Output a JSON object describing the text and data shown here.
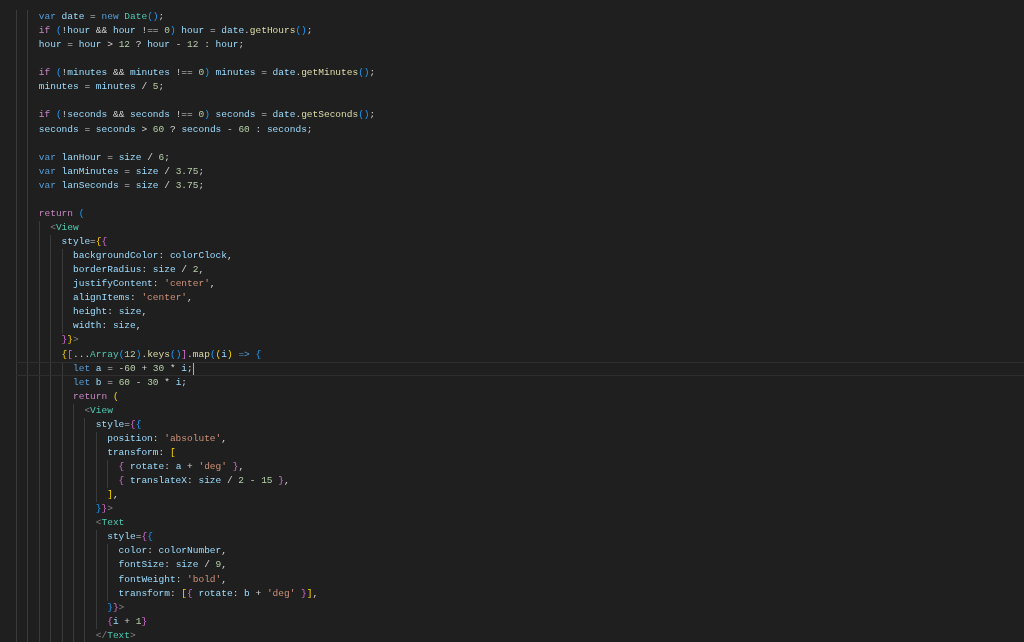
{
  "editor": {
    "lines": [
      {
        "kind": "code",
        "current": false,
        "tokens": [
          {
            "kind": "storage",
            "text": "    var "
          },
          {
            "kind": "variable",
            "text": "date"
          },
          {
            "kind": "plain",
            "text": " = "
          },
          {
            "kind": "storage",
            "text": "new "
          },
          {
            "kind": "type",
            "text": "Date"
          },
          {
            "kind": "blue",
            "text": "()"
          },
          {
            "kind": "plain",
            "text": ";"
          }
        ]
      },
      {
        "kind": "code",
        "current": false,
        "tokens": [
          {
            "kind": "keyword",
            "text": "    if "
          },
          {
            "kind": "blue",
            "text": "("
          },
          {
            "kind": "plain",
            "text": "!"
          },
          {
            "kind": "variable",
            "text": "hour"
          },
          {
            "kind": "plain",
            "text": " && "
          },
          {
            "kind": "variable",
            "text": "hour"
          },
          {
            "kind": "plain",
            "text": " !== "
          },
          {
            "kind": "number",
            "text": "0"
          },
          {
            "kind": "blue",
            "text": ")"
          },
          {
            "kind": "variable",
            "text": " hour"
          },
          {
            "kind": "plain",
            "text": " = "
          },
          {
            "kind": "variable",
            "text": "date"
          },
          {
            "kind": "plain",
            "text": "."
          },
          {
            "kind": "function",
            "text": "getHours"
          },
          {
            "kind": "blue",
            "text": "()"
          },
          {
            "kind": "plain",
            "text": ";"
          }
        ]
      },
      {
        "kind": "code",
        "current": false,
        "tokens": [
          {
            "kind": "variable",
            "text": "    hour"
          },
          {
            "kind": "plain",
            "text": " = "
          },
          {
            "kind": "variable",
            "text": "hour"
          },
          {
            "kind": "plain",
            "text": " > "
          },
          {
            "kind": "number",
            "text": "12"
          },
          {
            "kind": "plain",
            "text": " ? "
          },
          {
            "kind": "variable",
            "text": "hour"
          },
          {
            "kind": "plain",
            "text": " - "
          },
          {
            "kind": "number",
            "text": "12"
          },
          {
            "kind": "plain",
            "text": " : "
          },
          {
            "kind": "variable",
            "text": "hour"
          },
          {
            "kind": "plain",
            "text": ";"
          }
        ]
      },
      {
        "kind": "blank",
        "current": false
      },
      {
        "kind": "code",
        "current": false,
        "tokens": [
          {
            "kind": "keyword",
            "text": "    if "
          },
          {
            "kind": "blue",
            "text": "("
          },
          {
            "kind": "plain",
            "text": "!"
          },
          {
            "kind": "variable",
            "text": "minutes"
          },
          {
            "kind": "plain",
            "text": " && "
          },
          {
            "kind": "variable",
            "text": "minutes"
          },
          {
            "kind": "plain",
            "text": " !== "
          },
          {
            "kind": "number",
            "text": "0"
          },
          {
            "kind": "blue",
            "text": ")"
          },
          {
            "kind": "variable",
            "text": " minutes"
          },
          {
            "kind": "plain",
            "text": " = "
          },
          {
            "kind": "variable",
            "text": "date"
          },
          {
            "kind": "plain",
            "text": "."
          },
          {
            "kind": "function",
            "text": "getMinutes"
          },
          {
            "kind": "blue",
            "text": "()"
          },
          {
            "kind": "plain",
            "text": ";"
          }
        ]
      },
      {
        "kind": "code",
        "current": false,
        "tokens": [
          {
            "kind": "variable",
            "text": "    minutes"
          },
          {
            "kind": "plain",
            "text": " = "
          },
          {
            "kind": "variable",
            "text": "minutes"
          },
          {
            "kind": "plain",
            "text": " / "
          },
          {
            "kind": "number",
            "text": "5"
          },
          {
            "kind": "plain",
            "text": ";"
          }
        ]
      },
      {
        "kind": "blank",
        "current": false
      },
      {
        "kind": "code",
        "current": false,
        "tokens": [
          {
            "kind": "keyword",
            "text": "    if "
          },
          {
            "kind": "blue",
            "text": "("
          },
          {
            "kind": "plain",
            "text": "!"
          },
          {
            "kind": "variable",
            "text": "seconds"
          },
          {
            "kind": "plain",
            "text": " && "
          },
          {
            "kind": "variable",
            "text": "seconds"
          },
          {
            "kind": "plain",
            "text": " !== "
          },
          {
            "kind": "number",
            "text": "0"
          },
          {
            "kind": "blue",
            "text": ")"
          },
          {
            "kind": "variable",
            "text": " seconds"
          },
          {
            "kind": "plain",
            "text": " = "
          },
          {
            "kind": "variable",
            "text": "date"
          },
          {
            "kind": "plain",
            "text": "."
          },
          {
            "kind": "function",
            "text": "getSeconds"
          },
          {
            "kind": "blue",
            "text": "()"
          },
          {
            "kind": "plain",
            "text": ";"
          }
        ]
      },
      {
        "kind": "code",
        "current": false,
        "tokens": [
          {
            "kind": "variable",
            "text": "    seconds"
          },
          {
            "kind": "plain",
            "text": " = "
          },
          {
            "kind": "variable",
            "text": "seconds"
          },
          {
            "kind": "plain",
            "text": " > "
          },
          {
            "kind": "number",
            "text": "60"
          },
          {
            "kind": "plain",
            "text": " ? "
          },
          {
            "kind": "variable",
            "text": "seconds"
          },
          {
            "kind": "plain",
            "text": " - "
          },
          {
            "kind": "number",
            "text": "60"
          },
          {
            "kind": "plain",
            "text": " : "
          },
          {
            "kind": "variable",
            "text": "seconds"
          },
          {
            "kind": "plain",
            "text": ";"
          }
        ]
      },
      {
        "kind": "blank",
        "current": false
      },
      {
        "kind": "code",
        "current": false,
        "tokens": [
          {
            "kind": "storage",
            "text": "    var "
          },
          {
            "kind": "variable",
            "text": "lanHour"
          },
          {
            "kind": "plain",
            "text": " = "
          },
          {
            "kind": "variable",
            "text": "size"
          },
          {
            "kind": "plain",
            "text": " / "
          },
          {
            "kind": "number",
            "text": "6"
          },
          {
            "kind": "plain",
            "text": ";"
          }
        ]
      },
      {
        "kind": "code",
        "current": false,
        "tokens": [
          {
            "kind": "storage",
            "text": "    var "
          },
          {
            "kind": "variable",
            "text": "lanMinutes"
          },
          {
            "kind": "plain",
            "text": " = "
          },
          {
            "kind": "variable",
            "text": "size"
          },
          {
            "kind": "plain",
            "text": " / "
          },
          {
            "kind": "number",
            "text": "3.75"
          },
          {
            "kind": "plain",
            "text": ";"
          }
        ]
      },
      {
        "kind": "code",
        "current": false,
        "tokens": [
          {
            "kind": "storage",
            "text": "    var "
          },
          {
            "kind": "variable",
            "text": "lanSeconds"
          },
          {
            "kind": "plain",
            "text": " = "
          },
          {
            "kind": "variable",
            "text": "size"
          },
          {
            "kind": "plain",
            "text": " / "
          },
          {
            "kind": "number",
            "text": "3.75"
          },
          {
            "kind": "plain",
            "text": ";"
          }
        ]
      },
      {
        "kind": "blank",
        "current": false
      },
      {
        "kind": "code",
        "current": false,
        "tokens": [
          {
            "kind": "keyword",
            "text": "    return "
          },
          {
            "kind": "blue",
            "text": "("
          }
        ]
      },
      {
        "kind": "code",
        "current": false,
        "tokens": [
          {
            "kind": "tag",
            "text": "      <"
          },
          {
            "kind": "type",
            "text": "View"
          }
        ]
      },
      {
        "kind": "code",
        "current": false,
        "tokens": [
          {
            "kind": "variable",
            "text": "        style"
          },
          {
            "kind": "plain",
            "text": "="
          },
          {
            "kind": "gold",
            "text": "{"
          },
          {
            "kind": "purple",
            "text": "{"
          }
        ]
      },
      {
        "kind": "code",
        "current": false,
        "tokens": [
          {
            "kind": "variable",
            "text": "          backgroundColor"
          },
          {
            "kind": "plain",
            "text": ": "
          },
          {
            "kind": "variable",
            "text": "colorClock"
          },
          {
            "kind": "plain",
            "text": ","
          }
        ]
      },
      {
        "kind": "code",
        "current": false,
        "tokens": [
          {
            "kind": "variable",
            "text": "          borderRadius"
          },
          {
            "kind": "plain",
            "text": ": "
          },
          {
            "kind": "variable",
            "text": "size"
          },
          {
            "kind": "plain",
            "text": " / "
          },
          {
            "kind": "number",
            "text": "2"
          },
          {
            "kind": "plain",
            "text": ","
          }
        ]
      },
      {
        "kind": "code",
        "current": false,
        "tokens": [
          {
            "kind": "variable",
            "text": "          justifyContent"
          },
          {
            "kind": "plain",
            "text": ": "
          },
          {
            "kind": "string",
            "text": "'center'"
          },
          {
            "kind": "plain",
            "text": ","
          }
        ]
      },
      {
        "kind": "code",
        "current": false,
        "tokens": [
          {
            "kind": "variable",
            "text": "          alignItems"
          },
          {
            "kind": "plain",
            "text": ": "
          },
          {
            "kind": "string",
            "text": "'center'"
          },
          {
            "kind": "plain",
            "text": ","
          }
        ]
      },
      {
        "kind": "code",
        "current": false,
        "tokens": [
          {
            "kind": "variable",
            "text": "          height"
          },
          {
            "kind": "plain",
            "text": ": "
          },
          {
            "kind": "variable",
            "text": "size"
          },
          {
            "kind": "plain",
            "text": ","
          }
        ]
      },
      {
        "kind": "code",
        "current": false,
        "tokens": [
          {
            "kind": "variable",
            "text": "          width"
          },
          {
            "kind": "plain",
            "text": ": "
          },
          {
            "kind": "variable",
            "text": "size"
          },
          {
            "kind": "plain",
            "text": ","
          }
        ]
      },
      {
        "kind": "code",
        "current": false,
        "tokens": [
          {
            "kind": "purple",
            "text": "        }"
          },
          {
            "kind": "gold",
            "text": "}"
          },
          {
            "kind": "tag",
            "text": ">"
          }
        ]
      },
      {
        "kind": "code",
        "current": false,
        "tokens": [
          {
            "kind": "gold",
            "text": "        {"
          },
          {
            "kind": "purple",
            "text": "["
          },
          {
            "kind": "plain",
            "text": "..."
          },
          {
            "kind": "type",
            "text": "Array"
          },
          {
            "kind": "blue",
            "text": "("
          },
          {
            "kind": "number",
            "text": "12"
          },
          {
            "kind": "blue",
            "text": ")"
          },
          {
            "kind": "plain",
            "text": "."
          },
          {
            "kind": "function",
            "text": "keys"
          },
          {
            "kind": "blue",
            "text": "()"
          },
          {
            "kind": "purple",
            "text": "]"
          },
          {
            "kind": "plain",
            "text": "."
          },
          {
            "kind": "function",
            "text": "map"
          },
          {
            "kind": "blue",
            "text": "("
          },
          {
            "kind": "gold",
            "text": "("
          },
          {
            "kind": "variable",
            "text": "i"
          },
          {
            "kind": "gold",
            "text": ")"
          },
          {
            "kind": "storage",
            "text": " => "
          },
          {
            "kind": "blue",
            "text": "{"
          }
        ]
      },
      {
        "kind": "code",
        "current": true,
        "tokens": [
          {
            "kind": "storage",
            "text": "          let "
          },
          {
            "kind": "variable",
            "text": "a"
          },
          {
            "kind": "plain",
            "text": " = -"
          },
          {
            "kind": "number",
            "text": "60"
          },
          {
            "kind": "plain",
            "text": " + "
          },
          {
            "kind": "number",
            "text": "30"
          },
          {
            "kind": "plain",
            "text": " * "
          },
          {
            "kind": "variable",
            "text": "i"
          },
          {
            "kind": "plain",
            "text": ";"
          }
        ]
      },
      {
        "kind": "code",
        "current": false,
        "tokens": [
          {
            "kind": "storage",
            "text": "          let "
          },
          {
            "kind": "variable",
            "text": "b"
          },
          {
            "kind": "plain",
            "text": " = "
          },
          {
            "kind": "number",
            "text": "60"
          },
          {
            "kind": "plain",
            "text": " - "
          },
          {
            "kind": "number",
            "text": "30"
          },
          {
            "kind": "plain",
            "text": " * "
          },
          {
            "kind": "variable",
            "text": "i"
          },
          {
            "kind": "plain",
            "text": ";"
          }
        ]
      },
      {
        "kind": "code",
        "current": false,
        "tokens": [
          {
            "kind": "keyword",
            "text": "          return "
          },
          {
            "kind": "gold",
            "text": "("
          }
        ]
      },
      {
        "kind": "code",
        "current": false,
        "tokens": [
          {
            "kind": "tag",
            "text": "            <"
          },
          {
            "kind": "type",
            "text": "View"
          }
        ]
      },
      {
        "kind": "code",
        "current": false,
        "tokens": [
          {
            "kind": "variable",
            "text": "              style"
          },
          {
            "kind": "plain",
            "text": "="
          },
          {
            "kind": "purple",
            "text": "{"
          },
          {
            "kind": "blue",
            "text": "{"
          }
        ]
      },
      {
        "kind": "code",
        "current": false,
        "tokens": [
          {
            "kind": "variable",
            "text": "                position"
          },
          {
            "kind": "plain",
            "text": ": "
          },
          {
            "kind": "string",
            "text": "'absolute'"
          },
          {
            "kind": "plain",
            "text": ","
          }
        ]
      },
      {
        "kind": "code",
        "current": false,
        "tokens": [
          {
            "kind": "variable",
            "text": "                transform"
          },
          {
            "kind": "plain",
            "text": ": "
          },
          {
            "kind": "gold",
            "text": "["
          }
        ]
      },
      {
        "kind": "code",
        "current": false,
        "tokens": [
          {
            "kind": "purple",
            "text": "                  {"
          },
          {
            "kind": "variable",
            "text": " rotate"
          },
          {
            "kind": "plain",
            "text": ": "
          },
          {
            "kind": "variable",
            "text": "a"
          },
          {
            "kind": "plain",
            "text": " + "
          },
          {
            "kind": "string",
            "text": "'deg' "
          },
          {
            "kind": "purple",
            "text": "}"
          },
          {
            "kind": "plain",
            "text": ","
          }
        ]
      },
      {
        "kind": "code",
        "current": false,
        "tokens": [
          {
            "kind": "purple",
            "text": "                  {"
          },
          {
            "kind": "variable",
            "text": " translateX"
          },
          {
            "kind": "plain",
            "text": ": "
          },
          {
            "kind": "variable",
            "text": "size"
          },
          {
            "kind": "plain",
            "text": " / "
          },
          {
            "kind": "number",
            "text": "2"
          },
          {
            "kind": "plain",
            "text": " - "
          },
          {
            "kind": "number",
            "text": "15 "
          },
          {
            "kind": "purple",
            "text": "}"
          },
          {
            "kind": "plain",
            "text": ","
          }
        ]
      },
      {
        "kind": "code",
        "current": false,
        "tokens": [
          {
            "kind": "gold",
            "text": "                ]"
          },
          {
            "kind": "plain",
            "text": ","
          }
        ]
      },
      {
        "kind": "code",
        "current": false,
        "tokens": [
          {
            "kind": "blue",
            "text": "              }"
          },
          {
            "kind": "purple",
            "text": "}"
          },
          {
            "kind": "tag",
            "text": ">"
          }
        ]
      },
      {
        "kind": "code",
        "current": false,
        "tokens": [
          {
            "kind": "tag",
            "text": "              <"
          },
          {
            "kind": "type",
            "text": "Text"
          }
        ]
      },
      {
        "kind": "code",
        "current": false,
        "tokens": [
          {
            "kind": "variable",
            "text": "                style"
          },
          {
            "kind": "plain",
            "text": "="
          },
          {
            "kind": "purple",
            "text": "{"
          },
          {
            "kind": "blue",
            "text": "{"
          }
        ]
      },
      {
        "kind": "code",
        "current": false,
        "tokens": [
          {
            "kind": "variable",
            "text": "                  color"
          },
          {
            "kind": "plain",
            "text": ": "
          },
          {
            "kind": "variable",
            "text": "colorNumber"
          },
          {
            "kind": "plain",
            "text": ","
          }
        ]
      },
      {
        "kind": "code",
        "current": false,
        "tokens": [
          {
            "kind": "variable",
            "text": "                  fontSize"
          },
          {
            "kind": "plain",
            "text": ": "
          },
          {
            "kind": "variable",
            "text": "size"
          },
          {
            "kind": "plain",
            "text": " / "
          },
          {
            "kind": "number",
            "text": "9"
          },
          {
            "kind": "plain",
            "text": ","
          }
        ]
      },
      {
        "kind": "code",
        "current": false,
        "tokens": [
          {
            "kind": "variable",
            "text": "                  fontWeight"
          },
          {
            "kind": "plain",
            "text": ": "
          },
          {
            "kind": "string",
            "text": "'bold'"
          },
          {
            "kind": "plain",
            "text": ","
          }
        ]
      },
      {
        "kind": "code",
        "current": false,
        "tokens": [
          {
            "kind": "variable",
            "text": "                  transform"
          },
          {
            "kind": "plain",
            "text": ": "
          },
          {
            "kind": "gold",
            "text": "["
          },
          {
            "kind": "purple",
            "text": "{"
          },
          {
            "kind": "variable",
            "text": " rotate"
          },
          {
            "kind": "plain",
            "text": ": "
          },
          {
            "kind": "variable",
            "text": "b"
          },
          {
            "kind": "plain",
            "text": " + "
          },
          {
            "kind": "string",
            "text": "'deg' "
          },
          {
            "kind": "purple",
            "text": "}"
          },
          {
            "kind": "gold",
            "text": "]"
          },
          {
            "kind": "plain",
            "text": ","
          }
        ]
      },
      {
        "kind": "code",
        "current": false,
        "tokens": [
          {
            "kind": "blue",
            "text": "                }"
          },
          {
            "kind": "purple",
            "text": "}"
          },
          {
            "kind": "tag",
            "text": ">"
          }
        ]
      },
      {
        "kind": "code",
        "current": false,
        "tokens": [
          {
            "kind": "purple",
            "text": "                {"
          },
          {
            "kind": "variable",
            "text": "i"
          },
          {
            "kind": "plain",
            "text": " + "
          },
          {
            "kind": "number",
            "text": "1"
          },
          {
            "kind": "purple",
            "text": "}"
          }
        ]
      },
      {
        "kind": "code",
        "current": false,
        "tokens": [
          {
            "kind": "tag",
            "text": "              </"
          },
          {
            "kind": "type",
            "text": "Text"
          },
          {
            "kind": "tag",
            "text": ">"
          }
        ]
      }
    ]
  }
}
